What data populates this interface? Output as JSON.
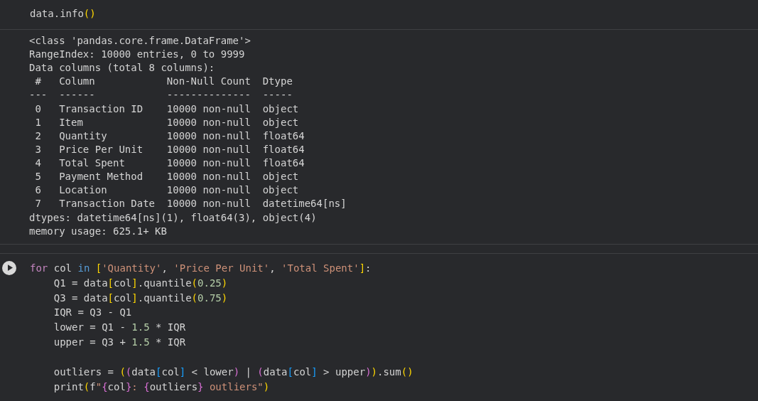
{
  "cells": [
    {
      "lines": [
        {
          "kind": "code",
          "tokens": [
            {
              "text": "data.info",
              "kind": "plain"
            },
            {
              "text": "()",
              "kind": "paren1"
            }
          ]
        }
      ],
      "output": {
        "lines_before": [
          "<class 'pandas.core.frame.DataFrame'>",
          "RangeIndex: 10000 entries, 0 to 9999",
          "Data columns (total 8 columns):"
        ],
        "table": {
          "columns": [
            "#",
            "Column",
            "Non-Null Count",
            "Dtype"
          ],
          "rules": [
            "---",
            "------",
            "--------------",
            "-----"
          ],
          "rows": [
            [
              "0",
              "Transaction ID",
              "10000 non-null",
              "object"
            ],
            [
              "1",
              "Item",
              "10000 non-null",
              "object"
            ],
            [
              "2",
              "Quantity",
              "10000 non-null",
              "float64"
            ],
            [
              "3",
              "Price Per Unit",
              "10000 non-null",
              "float64"
            ],
            [
              "4",
              "Total Spent",
              "10000 non-null",
              "float64"
            ],
            [
              "5",
              "Payment Method",
              "10000 non-null",
              "object"
            ],
            [
              "6",
              "Location",
              "10000 non-null",
              "object"
            ],
            [
              "7",
              "Transaction Date",
              "10000 non-null",
              "datetime64[ns]"
            ]
          ]
        },
        "lines_after": [
          "dtypes: datetime64[ns](1), float64(3), object(4)",
          "memory usage: 625.1+ KB"
        ]
      }
    },
    {
      "run_button": true,
      "lines": [
        {
          "kind": "code",
          "tokens": [
            {
              "text": "for",
              "kind": "control"
            },
            {
              "text": " col ",
              "kind": "plain"
            },
            {
              "text": "in ",
              "kind": "keyword"
            },
            {
              "text": "[",
              "kind": "paren1"
            },
            {
              "text": "'Quantity'",
              "kind": "string"
            },
            {
              "text": ", ",
              "kind": "plain"
            },
            {
              "text": "'Price Per Unit'",
              "kind": "string"
            },
            {
              "text": ", ",
              "kind": "plain"
            },
            {
              "text": "'Total Spent'",
              "kind": "string"
            },
            {
              "text": "]",
              "kind": "paren1"
            },
            {
              "text": ":",
              "kind": "plain"
            }
          ],
          "children": [
            {
              "kind": "code",
              "tokens": [
                {
                  "text": "Q1 = data",
                  "kind": "plain"
                },
                {
                  "text": "[",
                  "kind": "paren1"
                },
                {
                  "text": "col",
                  "kind": "plain"
                },
                {
                  "text": "]",
                  "kind": "paren1"
                },
                {
                  "text": ".quantile",
                  "kind": "plain"
                },
                {
                  "text": "(",
                  "kind": "paren1"
                },
                {
                  "text": "0.25",
                  "kind": "number"
                },
                {
                  "text": ")",
                  "kind": "paren1"
                }
              ]
            },
            {
              "kind": "code",
              "tokens": [
                {
                  "text": "Q3 = data",
                  "kind": "plain"
                },
                {
                  "text": "[",
                  "kind": "paren1"
                },
                {
                  "text": "col",
                  "kind": "plain"
                },
                {
                  "text": "]",
                  "kind": "paren1"
                },
                {
                  "text": ".quantile",
                  "kind": "plain"
                },
                {
                  "text": "(",
                  "kind": "paren1"
                },
                {
                  "text": "0.75",
                  "kind": "number"
                },
                {
                  "text": ")",
                  "kind": "paren1"
                }
              ]
            },
            {
              "kind": "code",
              "tokens": [
                {
                  "text": "IQR = Q3 - Q1",
                  "kind": "plain"
                }
              ]
            },
            {
              "kind": "code",
              "tokens": [
                {
                  "text": "lower = Q1 - ",
                  "kind": "plain"
                },
                {
                  "text": "1.5",
                  "kind": "number"
                },
                {
                  "text": " * IQR",
                  "kind": "plain"
                }
              ]
            },
            {
              "kind": "code",
              "tokens": [
                {
                  "text": "upper = Q3 + ",
                  "kind": "plain"
                },
                {
                  "text": "1.5",
                  "kind": "number"
                },
                {
                  "text": " * IQR",
                  "kind": "plain"
                }
              ]
            },
            {
              "kind": "blank"
            },
            {
              "kind": "code",
              "tokens": [
                {
                  "text": "outliers = ",
                  "kind": "plain"
                },
                {
                  "text": "(",
                  "kind": "paren1"
                },
                {
                  "text": "(",
                  "kind": "paren2"
                },
                {
                  "text": "data",
                  "kind": "plain"
                },
                {
                  "text": "[",
                  "kind": "paren3"
                },
                {
                  "text": "col",
                  "kind": "plain"
                },
                {
                  "text": "]",
                  "kind": "paren3"
                },
                {
                  "text": " < lower",
                  "kind": "plain"
                },
                {
                  "text": ")",
                  "kind": "paren2"
                },
                {
                  "text": " | ",
                  "kind": "plain"
                },
                {
                  "text": "(",
                  "kind": "paren2"
                },
                {
                  "text": "data",
                  "kind": "plain"
                },
                {
                  "text": "[",
                  "kind": "paren3"
                },
                {
                  "text": "col",
                  "kind": "plain"
                },
                {
                  "text": "]",
                  "kind": "paren3"
                },
                {
                  "text": " > upper",
                  "kind": "plain"
                },
                {
                  "text": ")",
                  "kind": "paren2"
                },
                {
                  "text": ")",
                  "kind": "paren1"
                },
                {
                  "text": ".sum",
                  "kind": "plain"
                },
                {
                  "text": "()",
                  "kind": "paren1"
                }
              ]
            },
            {
              "kind": "code",
              "tokens": [
                {
                  "text": "print",
                  "kind": "plain"
                },
                {
                  "text": "(",
                  "kind": "paren1"
                },
                {
                  "text": "f",
                  "kind": "plain"
                },
                {
                  "text": "\"",
                  "kind": "string"
                },
                {
                  "text": "{",
                  "kind": "paren2"
                },
                {
                  "text": "col",
                  "kind": "plain"
                },
                {
                  "text": "}",
                  "kind": "paren2"
                },
                {
                  "text": ": ",
                  "kind": "string"
                },
                {
                  "text": "{",
                  "kind": "paren2"
                },
                {
                  "text": "outliers",
                  "kind": "plain"
                },
                {
                  "text": "}",
                  "kind": "paren2"
                },
                {
                  "text": " outliers\"",
                  "kind": "string"
                },
                {
                  "text": ")",
                  "kind": "paren1"
                }
              ]
            }
          ]
        }
      ]
    }
  ]
}
